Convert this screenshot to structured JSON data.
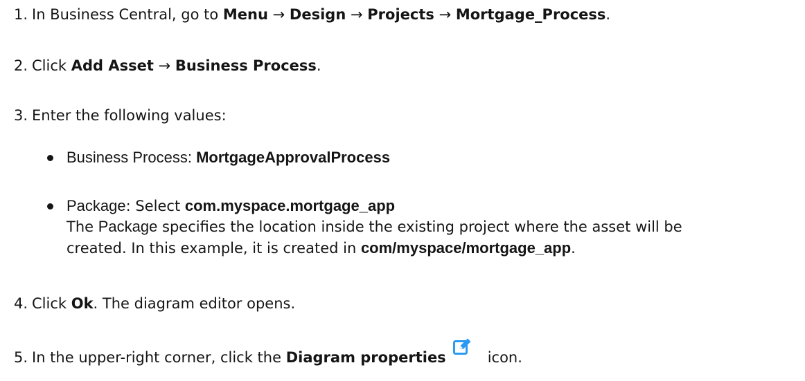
{
  "steps": [
    {
      "num": "1.",
      "text_a": "In Business Central, go to ",
      "path": [
        "Menu",
        "Design",
        "Projects",
        "Mortgage_Process"
      ],
      "arrow": "→",
      "end": "."
    },
    {
      "num": "2.",
      "text_a": "Click ",
      "path": [
        "Add Asset",
        "Business Process"
      ],
      "arrow": "→",
      "end": "."
    },
    {
      "num": "3.",
      "text_a": "Enter the following values:"
    },
    {
      "num": "4.",
      "text_a": "Click ",
      "ui": "Ok",
      "text_b": ". The diagram editor opens."
    },
    {
      "num": "5.",
      "text_a": "In the upper-right corner, click the ",
      "ui": "Diagram properties",
      "text_b": "icon.",
      "icon": "edit-icon"
    }
  ],
  "bullets": [
    {
      "label": "Business Process",
      "sep": ": ",
      "value": "MortgageApprovalProcess"
    },
    {
      "label": "Package",
      "sep": ": ",
      "text": "Select ",
      "value": "com.myspace.mortgage_app"
    }
  ],
  "package_note": {
    "line1_a": "The ",
    "line1_ui": "Package",
    "line1_b": " specifies the location inside the existing project where the asset will be",
    "line2_a": "created. In this example, it is created in ",
    "line2_value": "com/myspace/mortgage_app",
    "line2_end": "."
  },
  "colors": {
    "text": "#151515",
    "icon": "#2b9af3"
  }
}
